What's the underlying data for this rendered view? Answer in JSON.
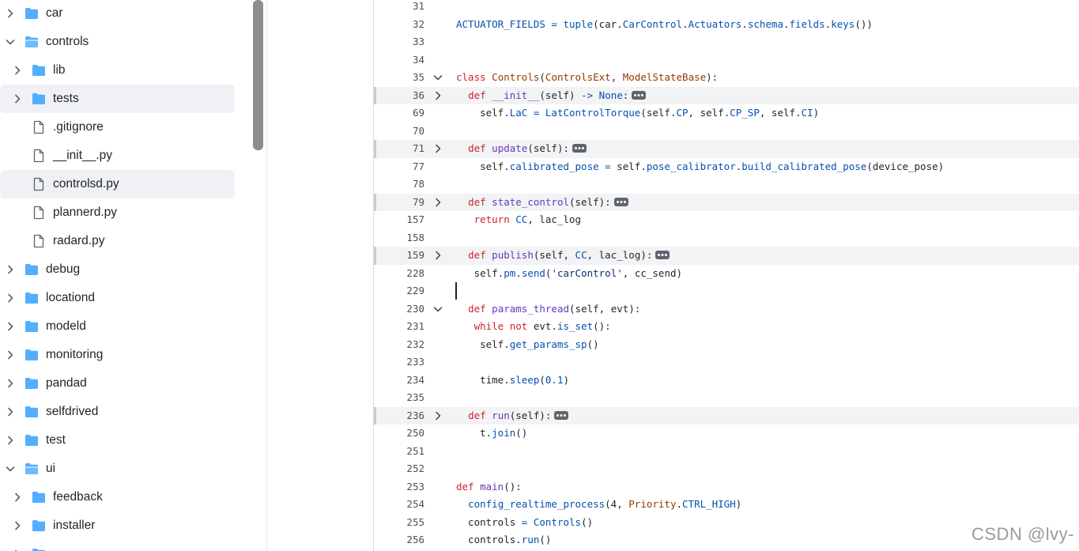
{
  "tree": [
    {
      "label": "car",
      "kind": "folder",
      "depth": 0,
      "expanded": false,
      "selected": false,
      "icon": "folder-icon"
    },
    {
      "label": "controls",
      "kind": "folder-open",
      "depth": 0,
      "expanded": true,
      "selected": false,
      "icon": "folder-open-icon"
    },
    {
      "label": "lib",
      "kind": "folder",
      "depth": 1,
      "expanded": false,
      "selected": false,
      "icon": "folder-icon"
    },
    {
      "label": "tests",
      "kind": "folder",
      "depth": 1,
      "expanded": false,
      "selected": true,
      "icon": "folder-icon"
    },
    {
      "label": ".gitignore",
      "kind": "file",
      "depth": 1,
      "selected": false,
      "icon": "file-icon"
    },
    {
      "label": "__init__.py",
      "kind": "file",
      "depth": 1,
      "selected": false,
      "icon": "file-icon"
    },
    {
      "label": "controlsd.py",
      "kind": "file",
      "depth": 1,
      "selected": true,
      "icon": "file-icon"
    },
    {
      "label": "plannerd.py",
      "kind": "file",
      "depth": 1,
      "selected": false,
      "icon": "file-icon"
    },
    {
      "label": "radard.py",
      "kind": "file",
      "depth": 1,
      "selected": false,
      "icon": "file-icon"
    },
    {
      "label": "debug",
      "kind": "folder",
      "depth": 0,
      "expanded": false,
      "selected": false,
      "icon": "folder-icon"
    },
    {
      "label": "locationd",
      "kind": "folder",
      "depth": 0,
      "expanded": false,
      "selected": false,
      "icon": "folder-icon"
    },
    {
      "label": "modeld",
      "kind": "folder",
      "depth": 0,
      "expanded": false,
      "selected": false,
      "icon": "folder-icon"
    },
    {
      "label": "monitoring",
      "kind": "folder",
      "depth": 0,
      "expanded": false,
      "selected": false,
      "icon": "folder-icon"
    },
    {
      "label": "pandad",
      "kind": "folder",
      "depth": 0,
      "expanded": false,
      "selected": false,
      "icon": "folder-icon"
    },
    {
      "label": "selfdrived",
      "kind": "folder",
      "depth": 0,
      "expanded": false,
      "selected": false,
      "icon": "folder-icon"
    },
    {
      "label": "test",
      "kind": "folder",
      "depth": 0,
      "expanded": false,
      "selected": false,
      "icon": "folder-icon"
    },
    {
      "label": "ui",
      "kind": "folder-open",
      "depth": 0,
      "expanded": true,
      "selected": false,
      "icon": "folder-open-icon"
    },
    {
      "label": "feedback",
      "kind": "folder",
      "depth": 1,
      "expanded": false,
      "selected": false,
      "icon": "folder-icon"
    },
    {
      "label": "installer",
      "kind": "folder",
      "depth": 1,
      "expanded": false,
      "selected": false,
      "icon": "folder-icon"
    },
    {
      "label": "",
      "kind": "folder",
      "depth": 1,
      "expanded": false,
      "selected": false,
      "icon": "folder-icon"
    }
  ],
  "code": [
    {
      "n": "31",
      "fold": null,
      "folded": false,
      "tokens": []
    },
    {
      "n": "32",
      "fold": null,
      "folded": false,
      "tokens": [
        [
          "id",
          "ACTUATOR_FIELDS"
        ],
        [
          "txt",
          " "
        ],
        [
          "id",
          "="
        ],
        [
          "txt",
          " "
        ],
        [
          "id",
          "tuple"
        ],
        [
          "txt",
          "(car."
        ],
        [
          "id",
          "CarControl"
        ],
        [
          "txt",
          "."
        ],
        [
          "id",
          "Actuators"
        ],
        [
          "txt",
          "."
        ],
        [
          "id",
          "schema"
        ],
        [
          "txt",
          "."
        ],
        [
          "id",
          "fields"
        ],
        [
          "txt",
          "."
        ],
        [
          "id",
          "keys"
        ],
        [
          "txt",
          "())"
        ]
      ]
    },
    {
      "n": "33",
      "fold": null,
      "folded": false,
      "tokens": []
    },
    {
      "n": "34",
      "fold": null,
      "folded": false,
      "tokens": []
    },
    {
      "n": "35",
      "fold": "open",
      "folded": false,
      "tokens": [
        [
          "kw",
          "class"
        ],
        [
          "txt",
          " "
        ],
        [
          "cls",
          "Controls"
        ],
        [
          "txt",
          "("
        ],
        [
          "cls",
          "ControlsExt"
        ],
        [
          "txt",
          ", "
        ],
        [
          "cls",
          "ModelStateBase"
        ],
        [
          "txt",
          "):"
        ]
      ]
    },
    {
      "n": "36",
      "fold": "closed",
      "folded": true,
      "ellipsis": true,
      "tokens": [
        [
          "txt",
          "  "
        ],
        [
          "kw",
          "def"
        ],
        [
          "txt",
          " "
        ],
        [
          "fn",
          "__init__"
        ],
        [
          "txt",
          "(self) "
        ],
        [
          "id",
          "->"
        ],
        [
          "txt",
          " "
        ],
        [
          "id",
          "None"
        ],
        [
          "txt",
          ":"
        ]
      ]
    },
    {
      "n": "69",
      "fold": null,
      "folded": false,
      "tokens": [
        [
          "txt",
          "    self."
        ],
        [
          "id",
          "LaC"
        ],
        [
          "txt",
          " "
        ],
        [
          "id",
          "="
        ],
        [
          "txt",
          " "
        ],
        [
          "id",
          "LatControlTorque"
        ],
        [
          "txt",
          "(self."
        ],
        [
          "id",
          "CP"
        ],
        [
          "txt",
          ", self."
        ],
        [
          "id",
          "CP_SP"
        ],
        [
          "txt",
          ", self."
        ],
        [
          "id",
          "CI"
        ],
        [
          "txt",
          ")"
        ]
      ]
    },
    {
      "n": "70",
      "fold": null,
      "folded": false,
      "tokens": []
    },
    {
      "n": "71",
      "fold": "closed",
      "folded": true,
      "ellipsis": true,
      "tokens": [
        [
          "txt",
          "  "
        ],
        [
          "kw",
          "def"
        ],
        [
          "txt",
          " "
        ],
        [
          "fn",
          "update"
        ],
        [
          "txt",
          "(self):"
        ]
      ]
    },
    {
      "n": "77",
      "fold": null,
      "folded": false,
      "tokens": [
        [
          "txt",
          "    self."
        ],
        [
          "id",
          "calibrated_pose"
        ],
        [
          "txt",
          " "
        ],
        [
          "id",
          "="
        ],
        [
          "txt",
          " self."
        ],
        [
          "id",
          "pose_calibrator"
        ],
        [
          "txt",
          "."
        ],
        [
          "id",
          "build_calibrated_pose"
        ],
        [
          "txt",
          "(device_pose)"
        ]
      ]
    },
    {
      "n": "78",
      "fold": null,
      "folded": false,
      "tokens": []
    },
    {
      "n": "79",
      "fold": "closed",
      "folded": true,
      "ellipsis": true,
      "tokens": [
        [
          "txt",
          "  "
        ],
        [
          "kw",
          "def"
        ],
        [
          "txt",
          " "
        ],
        [
          "fn",
          "state_control"
        ],
        [
          "txt",
          "(self):"
        ]
      ]
    },
    {
      "n": "157",
      "fold": null,
      "folded": false,
      "tokens": [
        [
          "txt",
          "   "
        ],
        [
          "kw",
          "return"
        ],
        [
          "txt",
          " "
        ],
        [
          "id",
          "CC"
        ],
        [
          "txt",
          ", lac_log"
        ]
      ]
    },
    {
      "n": "158",
      "fold": null,
      "folded": false,
      "tokens": []
    },
    {
      "n": "159",
      "fold": "closed",
      "folded": true,
      "ellipsis": true,
      "tokens": [
        [
          "txt",
          "  "
        ],
        [
          "kw",
          "def"
        ],
        [
          "txt",
          " "
        ],
        [
          "fn",
          "publish"
        ],
        [
          "txt",
          "(self, "
        ],
        [
          "id",
          "CC"
        ],
        [
          "txt",
          ", lac_log):"
        ]
      ]
    },
    {
      "n": "228",
      "fold": null,
      "folded": false,
      "tokens": [
        [
          "txt",
          "   self."
        ],
        [
          "id",
          "pm"
        ],
        [
          "txt",
          "."
        ],
        [
          "id",
          "send"
        ],
        [
          "txt",
          "("
        ],
        [
          "str",
          "'carControl'"
        ],
        [
          "txt",
          ", cc_send)"
        ]
      ]
    },
    {
      "n": "229",
      "fold": null,
      "folded": false,
      "tokens": []
    },
    {
      "n": "230",
      "fold": "open",
      "folded": false,
      "tokens": [
        [
          "txt",
          "  "
        ],
        [
          "kw",
          "def"
        ],
        [
          "txt",
          " "
        ],
        [
          "fn",
          "params_thread"
        ],
        [
          "txt",
          "(self, evt):"
        ]
      ]
    },
    {
      "n": "231",
      "fold": null,
      "folded": false,
      "tokens": [
        [
          "txt",
          "   "
        ],
        [
          "kw",
          "while"
        ],
        [
          "txt",
          " "
        ],
        [
          "kw",
          "not"
        ],
        [
          "txt",
          " evt."
        ],
        [
          "id",
          "is_set"
        ],
        [
          "txt",
          "():"
        ]
      ]
    },
    {
      "n": "232",
      "fold": null,
      "folded": false,
      "tokens": [
        [
          "txt",
          "    self."
        ],
        [
          "id",
          "get_params_sp"
        ],
        [
          "txt",
          "()"
        ]
      ]
    },
    {
      "n": "233",
      "fold": null,
      "folded": false,
      "tokens": []
    },
    {
      "n": "234",
      "fold": null,
      "folded": false,
      "tokens": [
        [
          "txt",
          "    time."
        ],
        [
          "id",
          "sleep"
        ],
        [
          "txt",
          "("
        ],
        [
          "num",
          "0.1"
        ],
        [
          "txt",
          ")"
        ]
      ]
    },
    {
      "n": "235",
      "fold": null,
      "folded": false,
      "tokens": []
    },
    {
      "n": "236",
      "fold": "closed",
      "folded": true,
      "ellipsis": true,
      "tokens": [
        [
          "txt",
          "  "
        ],
        [
          "kw",
          "def"
        ],
        [
          "txt",
          " "
        ],
        [
          "fn",
          "run"
        ],
        [
          "txt",
          "(self):"
        ]
      ]
    },
    {
      "n": "250",
      "fold": null,
      "folded": false,
      "tokens": [
        [
          "txt",
          "    t."
        ],
        [
          "id",
          "join"
        ],
        [
          "txt",
          "()"
        ]
      ]
    },
    {
      "n": "251",
      "fold": null,
      "folded": false,
      "tokens": []
    },
    {
      "n": "252",
      "fold": null,
      "folded": false,
      "tokens": []
    },
    {
      "n": "253",
      "fold": null,
      "folded": false,
      "tokens": [
        [
          "kw",
          "def"
        ],
        [
          "txt",
          " "
        ],
        [
          "fn",
          "main"
        ],
        [
          "txt",
          "():"
        ]
      ]
    },
    {
      "n": "254",
      "fold": null,
      "folded": false,
      "tokens": [
        [
          "txt",
          "  "
        ],
        [
          "id",
          "config_realtime_process"
        ],
        [
          "txt",
          "(4, "
        ],
        [
          "cls",
          "Priority"
        ],
        [
          "txt",
          "."
        ],
        [
          "id",
          "CTRL_HIGH"
        ],
        [
          "txt",
          ")"
        ]
      ]
    },
    {
      "n": "255",
      "fold": null,
      "folded": false,
      "tokens": [
        [
          "txt",
          "  controls "
        ],
        [
          "id",
          "="
        ],
        [
          "txt",
          " "
        ],
        [
          "id",
          "Controls"
        ],
        [
          "txt",
          "()"
        ]
      ]
    },
    {
      "n": "256",
      "fold": null,
      "folded": false,
      "tokens": [
        [
          "txt",
          "  controls."
        ],
        [
          "id",
          "run"
        ],
        [
          "txt",
          "()"
        ]
      ]
    }
  ],
  "watermark": "CSDN @lvy-",
  "colors": {
    "folder": "#54aeff",
    "keyword": "#cf222e",
    "function": "#6639ba",
    "identifier": "#0550ae",
    "class": "#953800"
  }
}
